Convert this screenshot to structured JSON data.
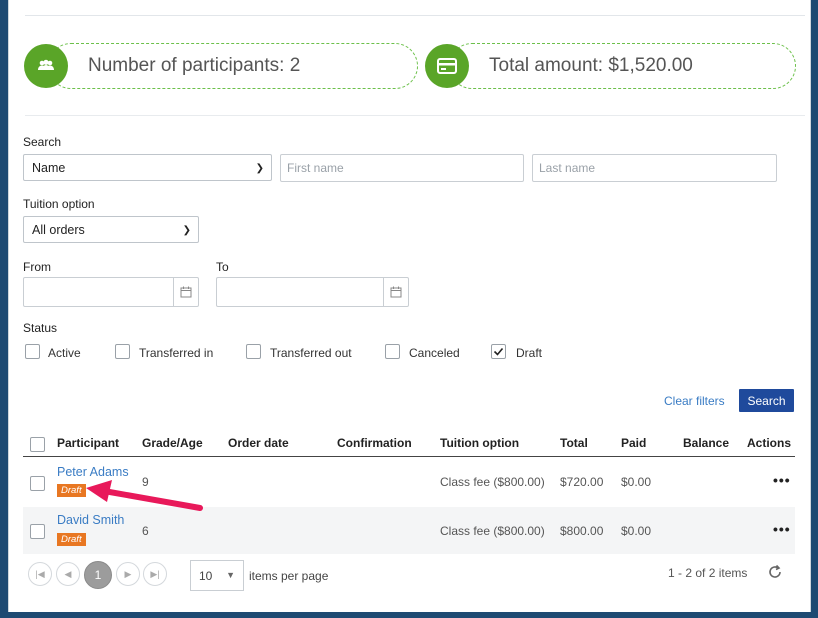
{
  "summary": {
    "participants_text": "Number of participants: 2",
    "total_text": "Total amount: $1,520.00",
    "icons": [
      "people-icon",
      "credit-card-icon"
    ],
    "accent": "#5aa528"
  },
  "filters": {
    "search_label": "Search",
    "search_by_value": "Name",
    "first_name_placeholder": "First name",
    "last_name_placeholder": "Last name",
    "tuition_label": "Tuition option",
    "tuition_value": "All orders",
    "from_label": "From",
    "to_label": "To",
    "status_label": "Status",
    "statuses": [
      {
        "label": "Active",
        "checked": false
      },
      {
        "label": "Transferred in",
        "checked": false
      },
      {
        "label": "Transferred out",
        "checked": false
      },
      {
        "label": "Canceled",
        "checked": false
      },
      {
        "label": "Draft",
        "checked": true
      }
    ],
    "clear_label": "Clear filters",
    "search_button": "Search"
  },
  "table": {
    "headers": [
      "Participant",
      "Grade/Age",
      "Order date",
      "Confirmation",
      "Tuition option",
      "Total",
      "Paid",
      "Balance",
      "Actions"
    ],
    "rows": [
      {
        "participant": "Peter Adams",
        "badge": "Draft",
        "grade": "9",
        "order_date": "",
        "confirmation": "",
        "tuition": "Class fee ($800.00)",
        "total": "$720.00",
        "paid": "$0.00",
        "balance": "",
        "actions": "•••"
      },
      {
        "participant": "David Smith",
        "badge": "Draft",
        "grade": "6",
        "order_date": "",
        "confirmation": "",
        "tuition": "Class fee ($800.00)",
        "total": "$800.00",
        "paid": "$0.00",
        "balance": "",
        "actions": "•••"
      }
    ]
  },
  "pager": {
    "current_page": "1",
    "page_size": "10",
    "items_per_page_label": "items per page",
    "range_text": "1 - 2 of 2 items"
  },
  "annotation": {
    "arrow_color": "#e8195a"
  }
}
